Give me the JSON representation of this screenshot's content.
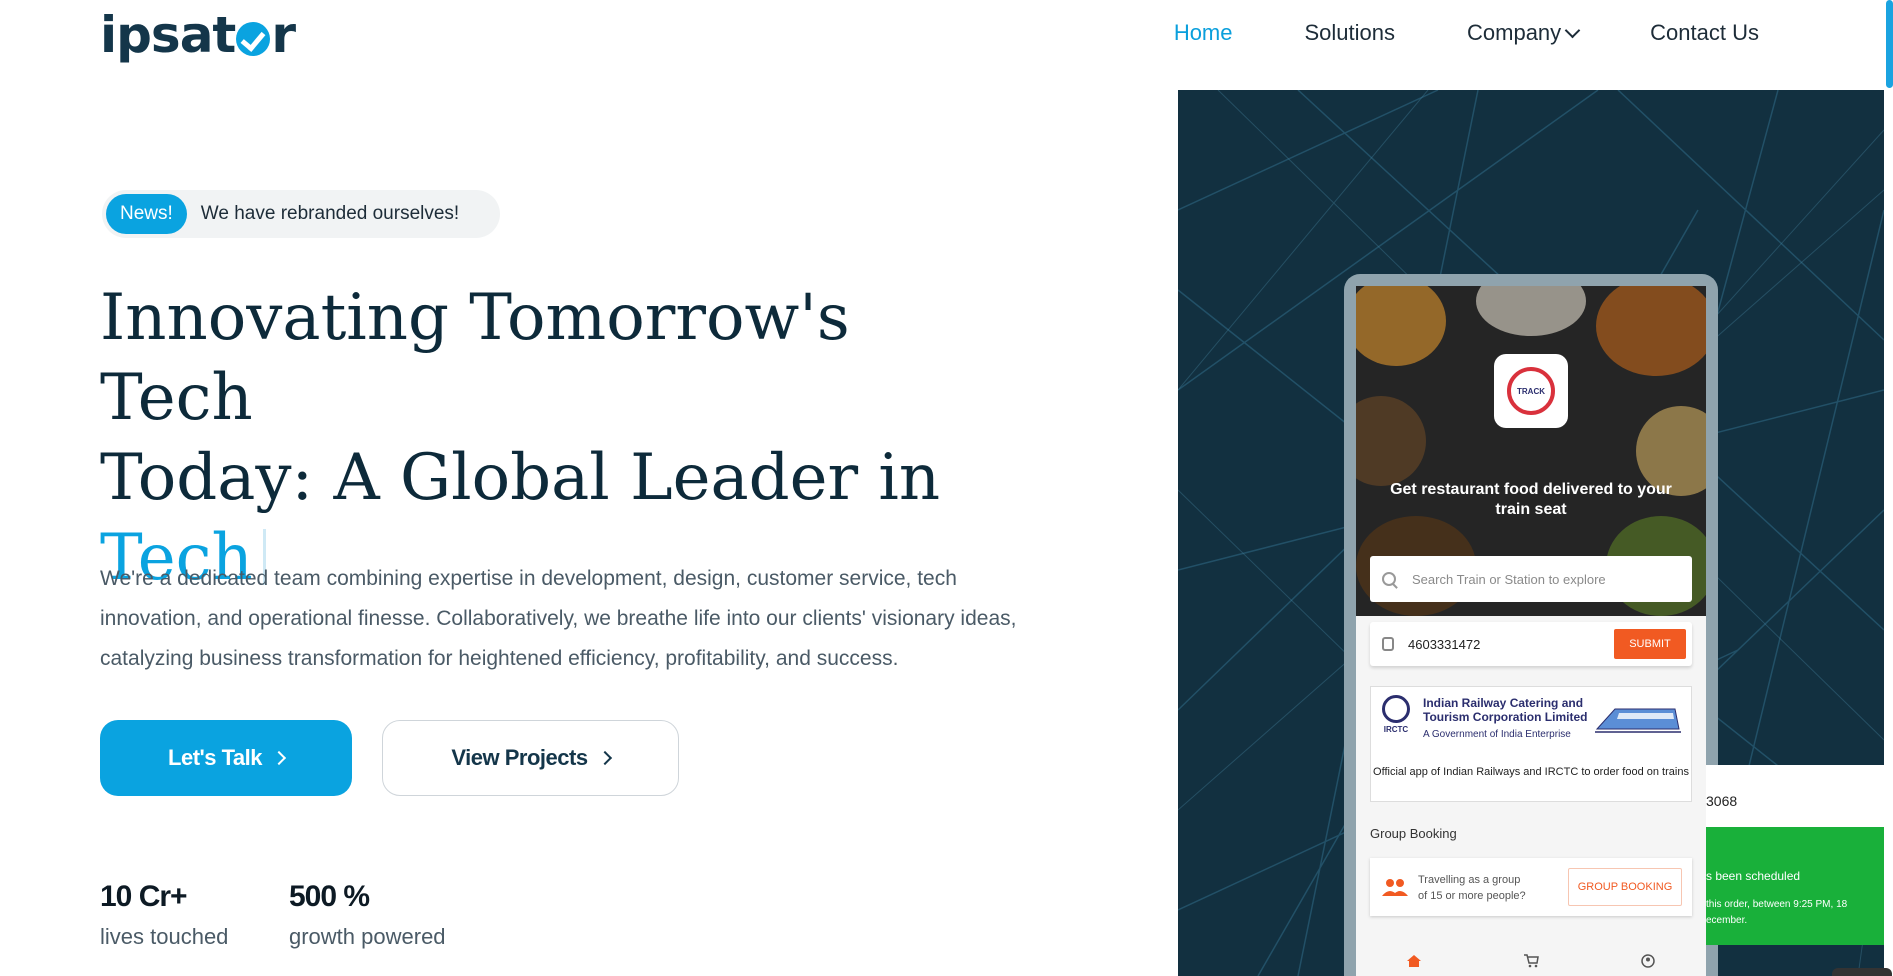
{
  "brand": {
    "logo_left": "ipsat",
    "logo_right": "r"
  },
  "nav": {
    "items": [
      {
        "label": "Home",
        "active": true
      },
      {
        "label": "Solutions",
        "active": false
      },
      {
        "label": "Company",
        "active": false,
        "dropdown": true
      },
      {
        "label": "Contact Us",
        "active": false
      }
    ]
  },
  "hero": {
    "news_tag": "News!",
    "news_text": "We have rebranded ourselves!",
    "headline_line1": "Innovating Tomorrow's Tech",
    "headline_line2": "Today: A Global Leader in",
    "headline_accent": "Tech",
    "description": "We're a dedicated team combining expertise in development, design, customer service, tech innovation, and operational finesse. Collaboratively, we breathe life into our clients' visionary ideas, catalyzing business transformation for heightened efficiency, profitability, and success.",
    "primary_button": "Let's Talk",
    "secondary_button": "View Projects",
    "stats": [
      {
        "value": "10 Cr+",
        "label": "lives touched"
      },
      {
        "value": "500 %",
        "label": "growth powered"
      }
    ]
  },
  "phone": {
    "tagline": "Get restaurant food delivered to your train seat",
    "search_placeholder": "Search Train or Station to explore",
    "pnr_value": "4603331472",
    "submit_label": "SUBMIT",
    "irctc_name": "Indian Railway Catering and Tourism Corporation Limited",
    "irctc_sub": "A Government of India Enterprise",
    "irctc_badge": "IRCTC",
    "irctc_official": "Official app of Indian Railways and IRCTC to order food on trains",
    "group_title": "Group Booking",
    "group_text": "Travelling as a group of 15 or more people?",
    "group_button": "GROUP BOOKING"
  },
  "overlay_card": {
    "pnr_fragment": "3068",
    "status_fragment": "s been scheduled",
    "detail_fragment": "this order, between 9:25 PM, 18 ecember."
  },
  "colors": {
    "accent": "#0aa3e0",
    "dark": "#0d2a3a",
    "orange": "#f15a22",
    "panel": "#123040",
    "green": "#19b03a"
  }
}
